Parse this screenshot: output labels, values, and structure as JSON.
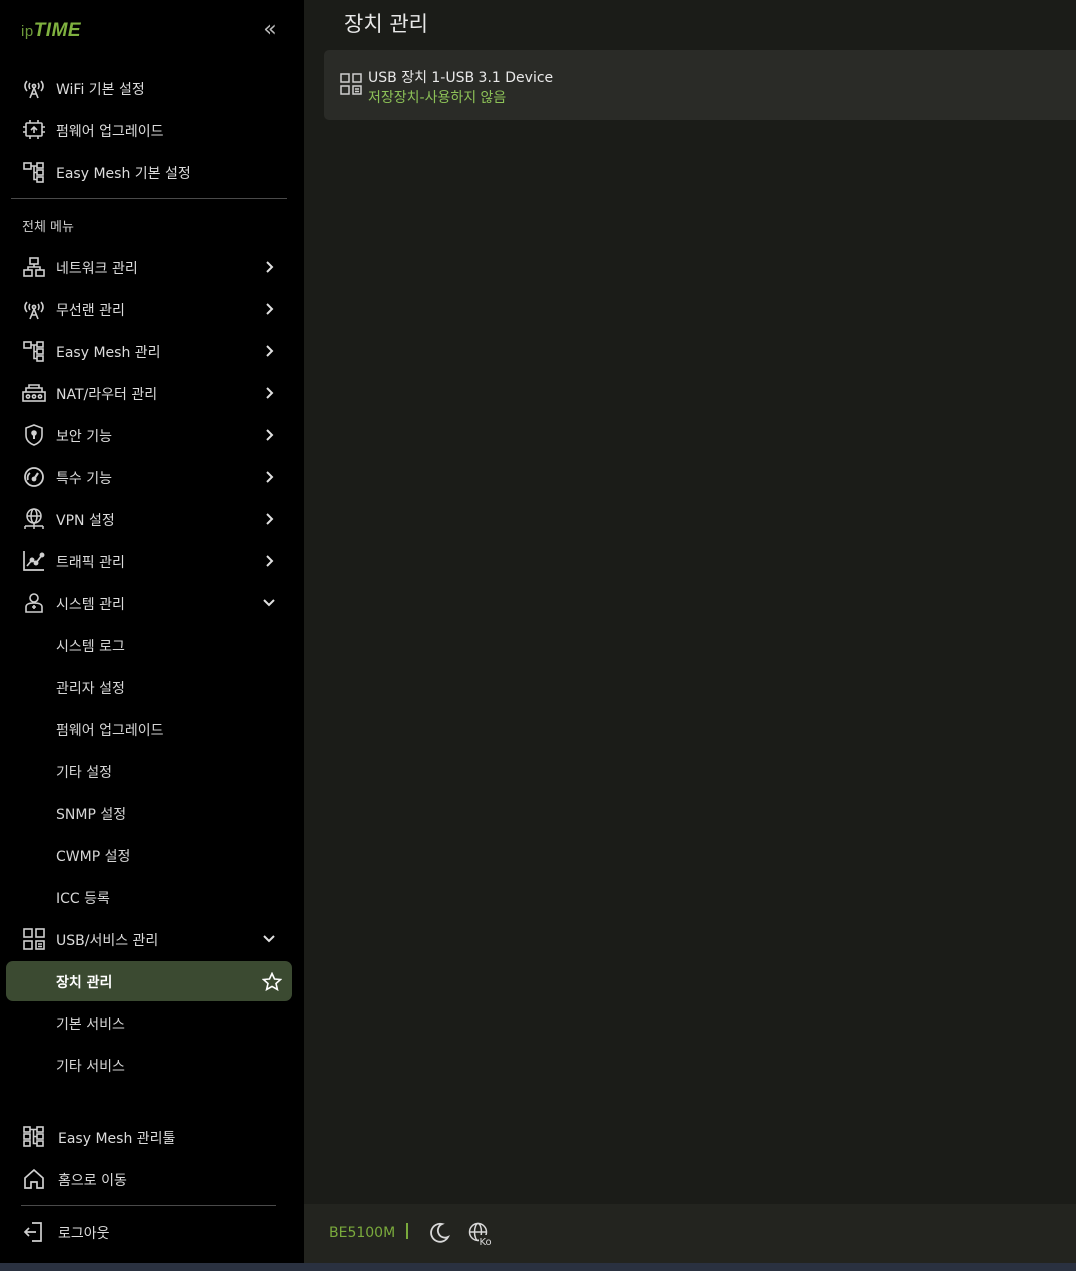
{
  "logo": {
    "ip": "ip",
    "time": "TIME"
  },
  "quick": [
    {
      "label": "WiFi 기본 설정",
      "icon": "wifi-antenna-icon"
    },
    {
      "label": "펌웨어 업그레이드",
      "icon": "firmware-chip-icon"
    },
    {
      "label": "Easy Mesh 기본 설정",
      "icon": "mesh-tree-icon"
    }
  ],
  "menu": {
    "section_title": "전체 메뉴",
    "items": [
      {
        "label": "네트워크 관리",
        "icon": "network-icon"
      },
      {
        "label": "무선랜 관리",
        "icon": "wifi-antenna-icon"
      },
      {
        "label": "Easy Mesh 관리",
        "icon": "mesh-tree-icon"
      },
      {
        "label": "NAT/라우터 관리",
        "icon": "router-icon"
      },
      {
        "label": "보안 기능",
        "icon": "shield-icon"
      },
      {
        "label": "특수 기능",
        "icon": "gauge-icon"
      },
      {
        "label": "VPN 설정",
        "icon": "globe-network-icon"
      },
      {
        "label": "트래픽 관리",
        "icon": "chart-line-icon"
      },
      {
        "label": "시스템 관리",
        "icon": "admin-user-icon"
      }
    ],
    "system_sub": [
      "시스템 로그",
      "관리자 설정",
      "펌웨어 업그레이드",
      "기타 설정",
      "SNMP 설정",
      "CWMP 설정",
      "ICC 등록"
    ],
    "usb": {
      "label": "USB/서비스 관리",
      "icon": "usb-grid-icon"
    },
    "usb_sub": [
      "장치 관리",
      "기본 서비스",
      "기타 서비스"
    ]
  },
  "bottom": [
    {
      "label": "Easy Mesh 관리툴",
      "icon": "mesh-tree-icon"
    },
    {
      "label": "홈으로 이동",
      "icon": "home-icon"
    }
  ],
  "logout": {
    "label": "로그아웃",
    "icon": "logout-icon"
  },
  "main": {
    "title": "장치 관리",
    "device": {
      "name": "USB 장치 1-USB 3.1 Device",
      "status": "저장장치-사용하지 않음"
    }
  },
  "footer": {
    "model": "BE5100M",
    "lang": "Ko"
  },
  "colors": {
    "accent": "#7aaa3c",
    "active_bg": "#3b4a31",
    "status": "#8cc157"
  }
}
